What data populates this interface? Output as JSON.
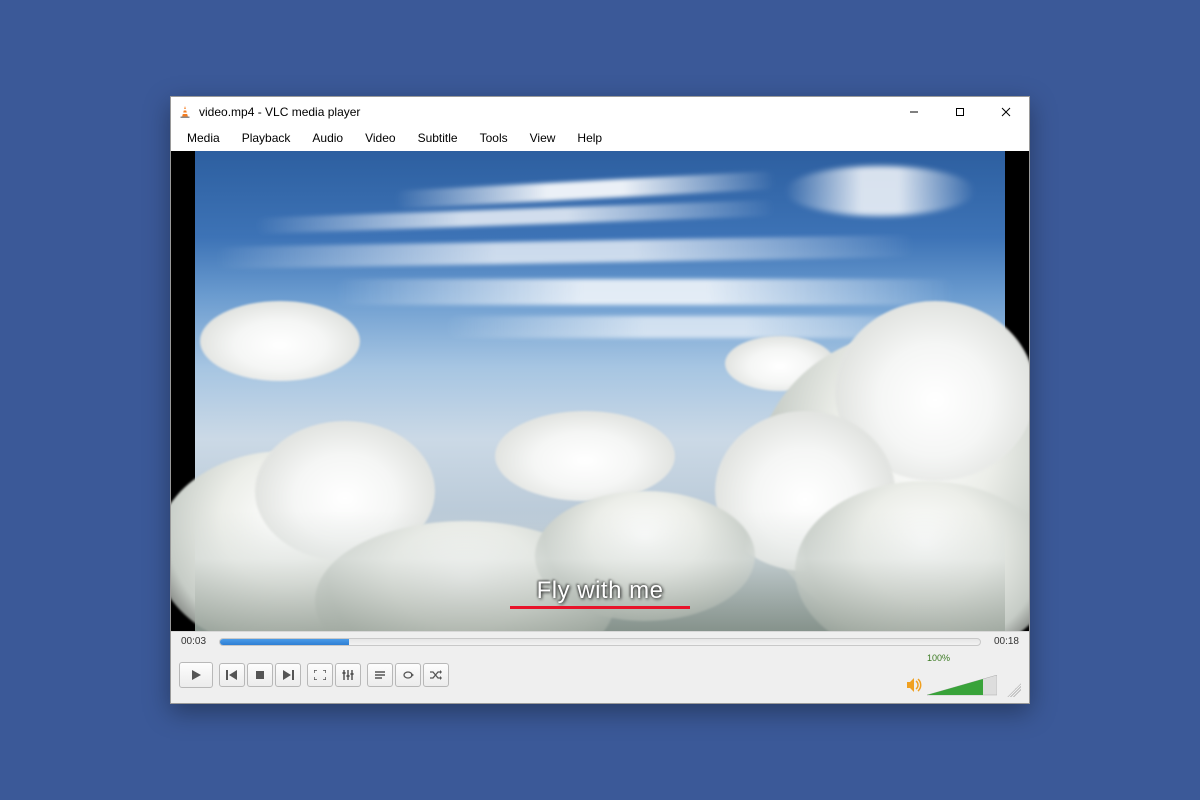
{
  "window": {
    "title": "video.mp4 - VLC media player"
  },
  "menu": {
    "items": [
      "Media",
      "Playback",
      "Audio",
      "Video",
      "Subtitle",
      "Tools",
      "View",
      "Help"
    ]
  },
  "subtitle": {
    "text": "Fly with me"
  },
  "playback": {
    "elapsed": "00:03",
    "total": "00:18",
    "progress_percent": 17
  },
  "volume": {
    "percent_label": "100%",
    "level_percent": 80
  },
  "colors": {
    "page_bg": "#3b5998",
    "seek_fill": "#2e7fd4",
    "subtitle_underline": "#e8132a",
    "volume_fill": "#39a33a"
  }
}
